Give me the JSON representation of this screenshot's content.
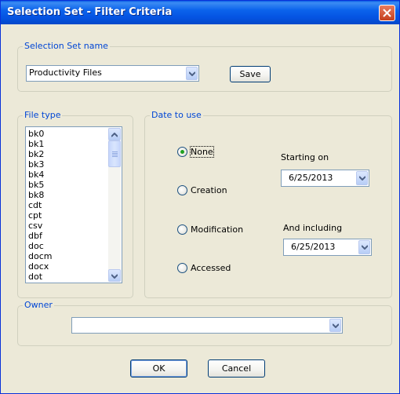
{
  "window": {
    "title": "Selection Set - Filter Criteria"
  },
  "selection_set": {
    "group_label": "Selection Set name",
    "name_value": "Productivity Files",
    "save_label": "Save"
  },
  "file_type": {
    "group_label": "File type",
    "items": [
      "bk0",
      "bk1",
      "bk2",
      "bk3",
      "bk4",
      "bk5",
      "bk8",
      "cdt",
      "cpt",
      "csv",
      "dbf",
      "doc",
      "docm",
      "docx",
      "dot"
    ]
  },
  "date_to_use": {
    "group_label": "Date to use",
    "options": [
      {
        "label": "None",
        "checked": true
      },
      {
        "label": "Creation",
        "checked": false
      },
      {
        "label": "Modification",
        "checked": false
      },
      {
        "label": "Accessed",
        "checked": false
      }
    ],
    "starting_on_label": "Starting on",
    "starting_on_value": "6/25/2013",
    "and_including_label": "And including",
    "and_including_value": "6/25/2013"
  },
  "owner": {
    "group_label": "Owner",
    "value": ""
  },
  "buttons": {
    "ok_label": "OK",
    "cancel_label": "Cancel"
  },
  "colors": {
    "title_bar": "#0554e3",
    "group_label": "#0046d5",
    "dialog_bg": "#ece9d8",
    "radio_dot": "#21a121"
  },
  "icons": {
    "close": "close-icon",
    "dropdown": "chevron-down-icon",
    "scroll_up": "chevron-up-icon",
    "scroll_down": "chevron-down-icon"
  }
}
